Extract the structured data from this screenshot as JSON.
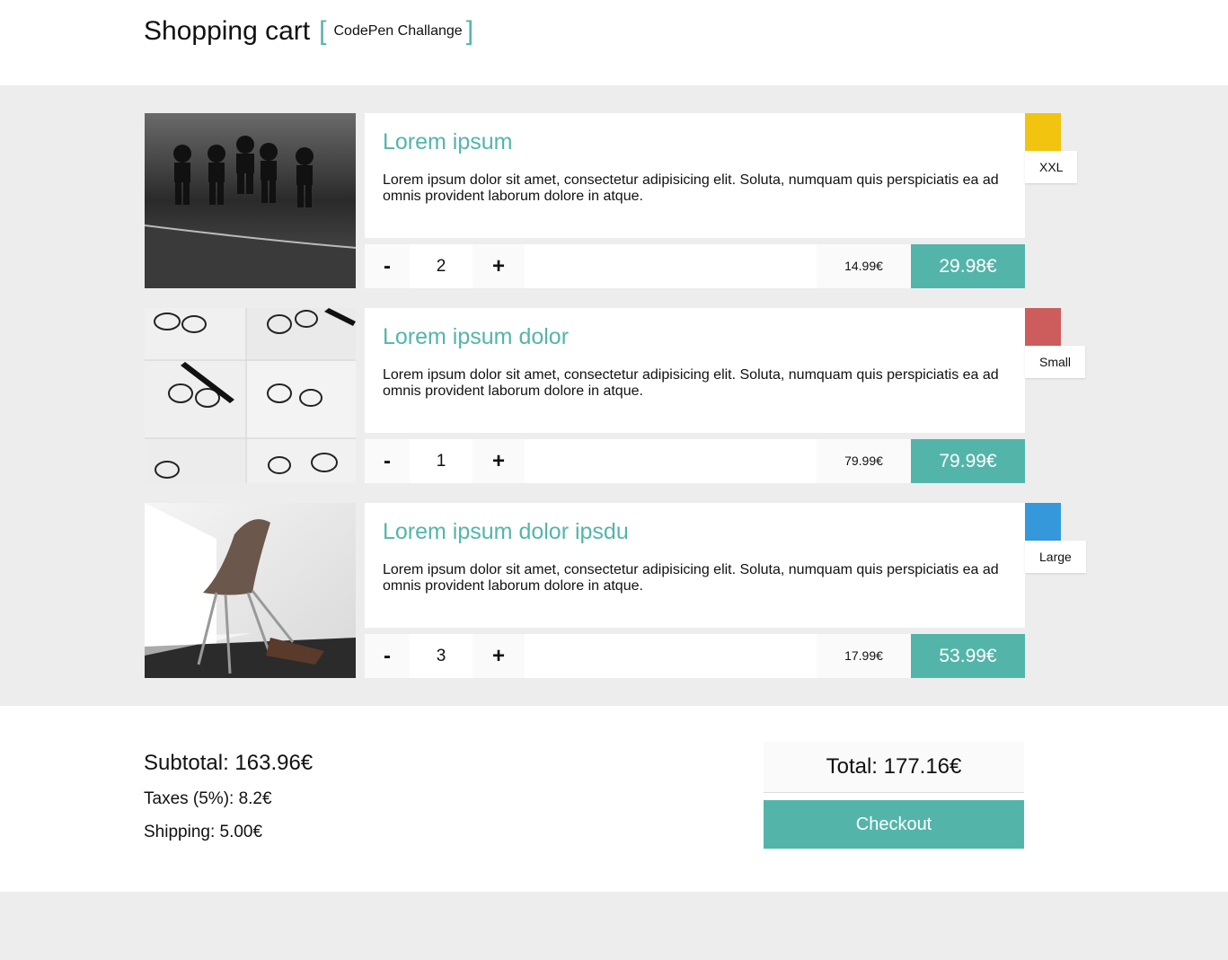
{
  "header": {
    "title": "Shopping cart",
    "subtitle": "CodePen Challange"
  },
  "items": [
    {
      "name": "Lorem ipsum",
      "description": "Lorem ipsum dolor sit amet, consectetur adipisicing elit. Soluta, numquam quis perspiciatis ea ad omnis provident laborum dolore in atque.",
      "quantity": "2",
      "unit_price": "14.99€",
      "total_price": "29.98€",
      "color": "#f1c40f",
      "size": "XXL",
      "minus_label": "-",
      "plus_label": "+"
    },
    {
      "name": "Lorem ipsum dolor",
      "description": "Lorem ipsum dolor sit amet, consectetur adipisicing elit. Soluta, numquam quis perspiciatis ea ad omnis provident laborum dolore in atque.",
      "quantity": "1",
      "unit_price": "79.99€",
      "total_price": "79.99€",
      "color": "#cd5c5c",
      "size": "Small",
      "minus_label": "-",
      "plus_label": "+"
    },
    {
      "name": "Lorem ipsum dolor ipsdu",
      "description": "Lorem ipsum dolor sit amet, consectetur adipisicing elit. Soluta, numquam quis perspiciatis ea ad omnis provident laborum dolore in atque.",
      "quantity": "3",
      "unit_price": "17.99€",
      "total_price": "53.99€",
      "color": "#3498db",
      "size": "Large",
      "minus_label": "-",
      "plus_label": "+"
    }
  ],
  "summary": {
    "subtotal": "Subtotal: 163.96€",
    "taxes": "Taxes (5%): 8.2€",
    "shipping": "Shipping: 5.00€",
    "total": "Total: 177.16€",
    "checkout_label": "Checkout"
  },
  "colors": {
    "accent": "#53b5aa",
    "background": "#ededed"
  }
}
